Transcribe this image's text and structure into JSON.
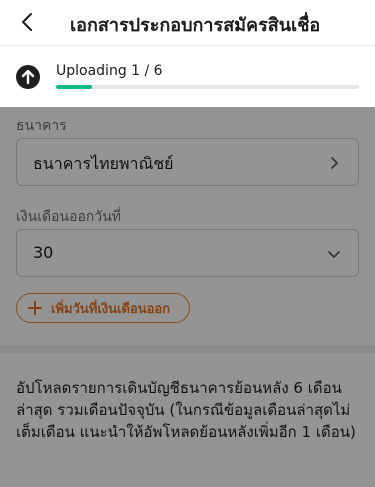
{
  "header": {
    "title": "เอกสารประกอบการสมัครสินเชื่อ",
    "back_icon": "chevron-left-icon"
  },
  "upload": {
    "status_text": "Uploading 1 / 6",
    "progress": 0.12,
    "icon": "upload-arrow-icon",
    "accent": "#10b981"
  },
  "form": {
    "bank_label": "ธนาคาร",
    "bank_value": "ธนาคารไทยพาณิชย์",
    "salary_day_label": "เงินเดือนออกวันที่",
    "salary_day_value": "30",
    "add_salary_day_label": "เพิ่มวันที่เงินเดือนออก",
    "add_color": "#e8731f"
  },
  "instructions": {
    "text": "อัปโหลดรายการเดินบัญชีธนาคารย้อนหลัง 6 เดือนล่าสุด รวมเดือนปัจจุบัน (ในกรณีข้อมูลเดือนล่าสุดไม่เต็มเดือน แนะนำให้อัพโหลดย้อนหลังเพิ่มอีก 1 เดือน)"
  }
}
